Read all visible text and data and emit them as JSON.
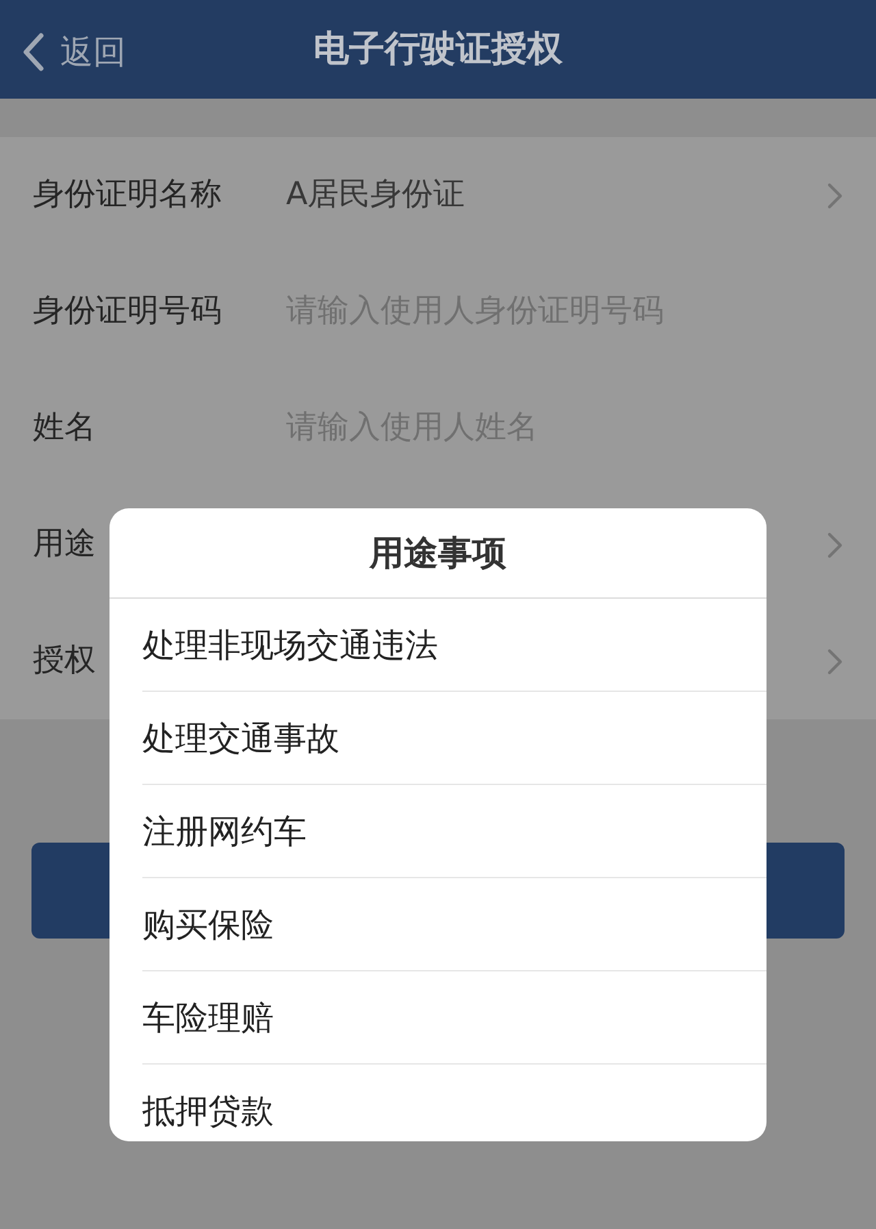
{
  "header": {
    "back_label": "返回",
    "title": "电子行驶证授权"
  },
  "form": [
    {
      "label": "身份证明名称",
      "kind": "select",
      "value": "A居民身份证"
    },
    {
      "label": "身份证明号码",
      "kind": "input",
      "placeholder": "请输入使用人身份证明号码"
    },
    {
      "label": "姓名",
      "kind": "input",
      "placeholder": "请输入使用人姓名"
    },
    {
      "label": "用途",
      "kind": "select"
    },
    {
      "label": "授权",
      "kind": "select"
    }
  ],
  "dialog": {
    "title": "用途事项",
    "items": [
      "处理非现场交通违法",
      "处理交通事故",
      "注册网约车",
      "购买保险",
      "车险理赔",
      "抵押贷款"
    ]
  }
}
